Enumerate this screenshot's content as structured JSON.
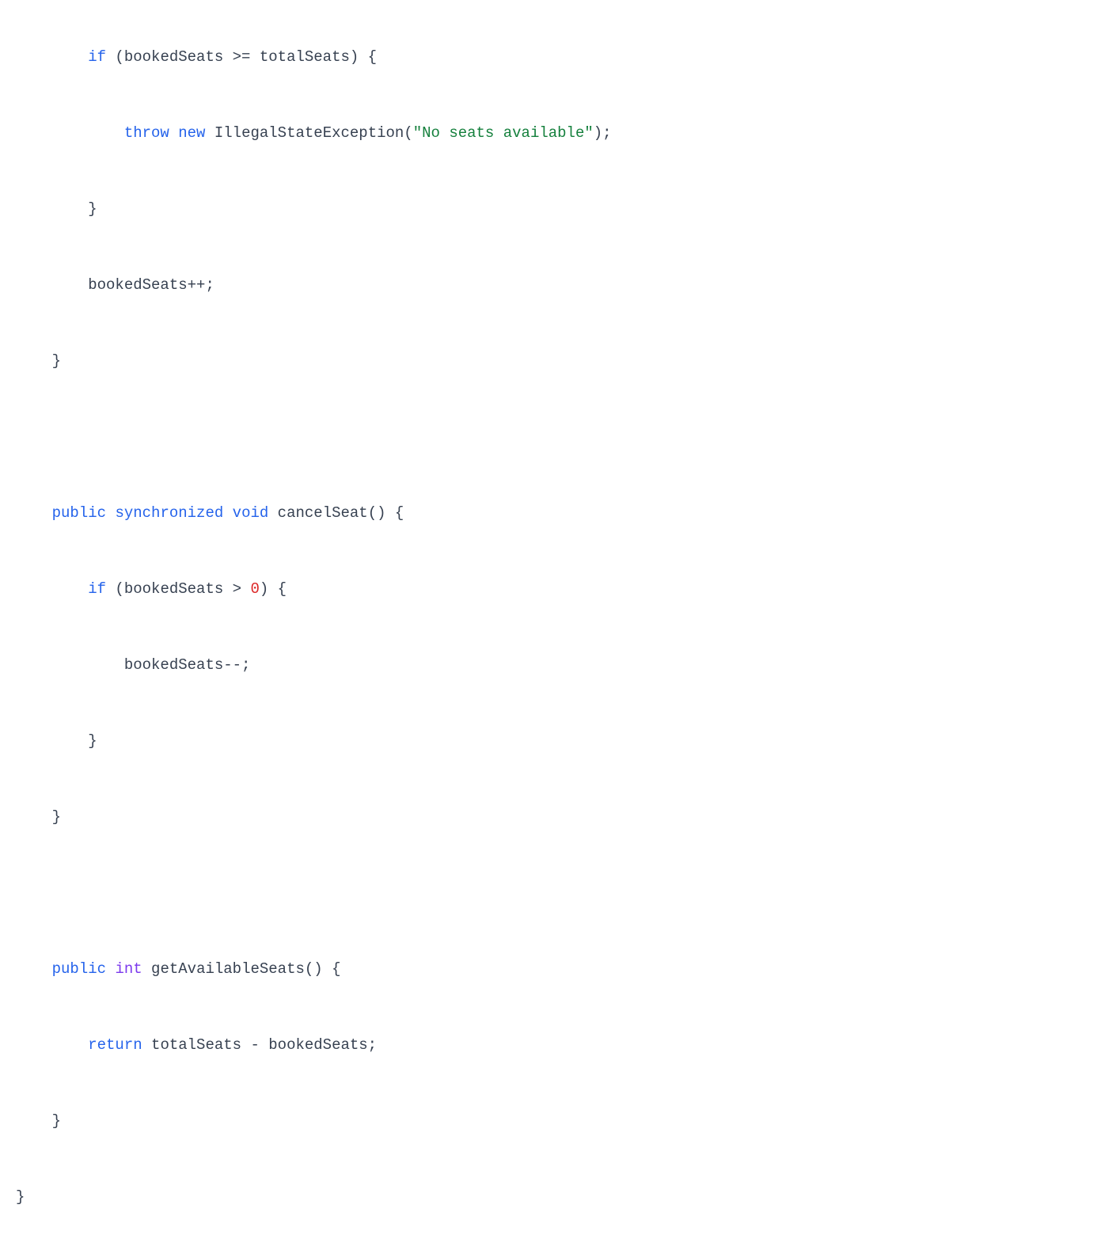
{
  "code": {
    "l1_indent": "        ",
    "l1_kw": "if",
    "l1_rest": " (bookedSeats >= totalSeats) {",
    "l2_indent": "            ",
    "l2_kw1": "throw",
    "l2_sp": " ",
    "l2_kw2": "new",
    "l2_mid": " IllegalStateException(",
    "l2_str": "\"No seats available\"",
    "l2_end": ");",
    "l3_indent": "        ",
    "l3_txt": "}",
    "l4_indent": "        ",
    "l4_txt": "bookedSeats++;",
    "l5_indent": "    ",
    "l5_txt": "}",
    "blank": "",
    "l6_indent": "    ",
    "l6_kw1": "public",
    "l6_sp1": " ",
    "l6_kw2": "synchronized",
    "l6_sp2": " ",
    "l6_kw3": "void",
    "l6_rest": " cancelSeat() {",
    "l7_indent": "        ",
    "l7_kw": "if",
    "l7_mid": " (bookedSeats > ",
    "l7_num": "0",
    "l7_end": ") {",
    "l8_indent": "            ",
    "l8_txt": "bookedSeats--;",
    "l9_indent": "        ",
    "l9_txt": "}",
    "l10_indent": "    ",
    "l10_txt": "}",
    "l11_indent": "    ",
    "l11_kw": "public",
    "l11_sp": " ",
    "l11_type": "int",
    "l11_rest": " getAvailableSeats() {",
    "l12_indent": "        ",
    "l12_kw": "return",
    "l12_rest": " totalSeats - bookedSeats;",
    "l13_indent": "    ",
    "l13_txt": "}",
    "l14_txt": "}"
  }
}
